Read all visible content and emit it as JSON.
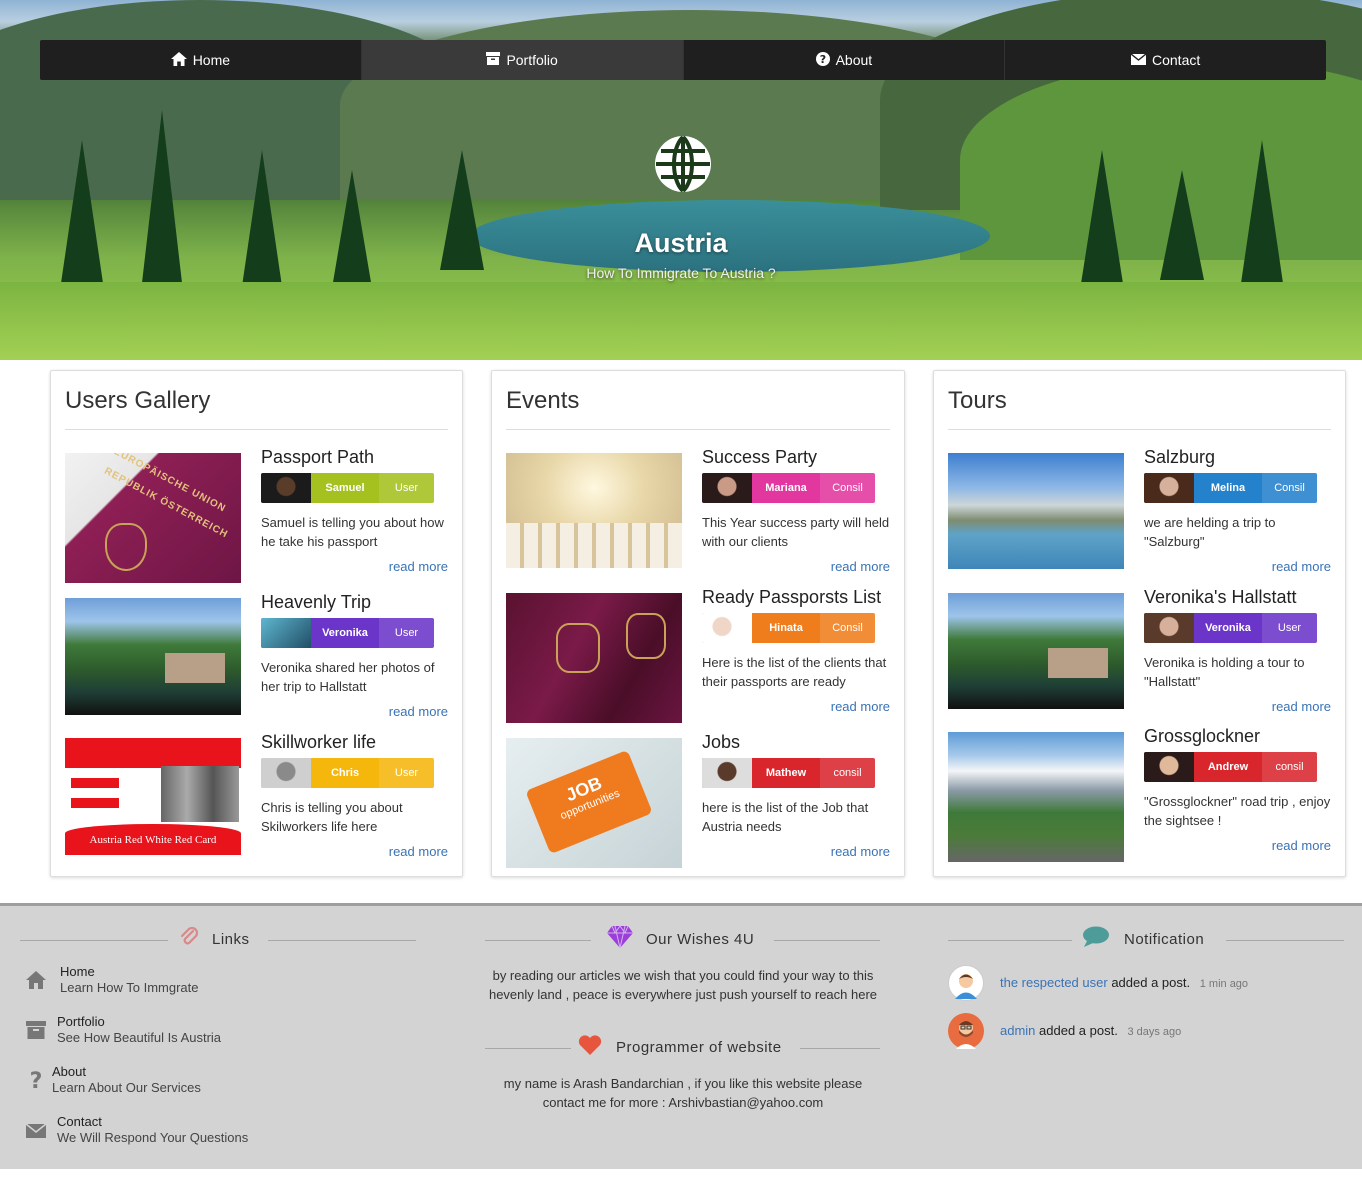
{
  "nav": {
    "items": [
      {
        "label": "Home",
        "icon": "home-icon"
      },
      {
        "label": "Portfolio",
        "icon": "archive-icon"
      },
      {
        "label": "About",
        "icon": "question-icon"
      },
      {
        "label": "Contact",
        "icon": "envelope-icon"
      }
    ],
    "active": "Portfolio"
  },
  "hero": {
    "title": "Austria",
    "subtitle": "How To Immigrate To Austria ?",
    "icon": "globe-icon"
  },
  "panels": [
    {
      "title": "Users Gallery",
      "items": [
        {
          "title": "Passport Path",
          "name": "Samuel",
          "role": "User",
          "color": "#a4c11f",
          "text": "Samuel is telling you about how he take his passport",
          "more": "read more"
        },
        {
          "title": "Heavenly Trip",
          "name": "Veronika",
          "role": "User",
          "color": "#6a35c8",
          "text": "Veronika shared her photos of her trip to Hallstatt",
          "more": "read more"
        },
        {
          "title": "Skillworker life",
          "name": "Chris",
          "role": "User",
          "color": "#f5b70c",
          "text": "Chris is telling you about Skilworkers life here",
          "more": "read more"
        }
      ]
    },
    {
      "title": "Events",
      "items": [
        {
          "title": "Success Party",
          "name": "Mariana",
          "role": "Consil",
          "color": "#e2379e",
          "text": "This Year success party will held with our clients",
          "more": "read more"
        },
        {
          "title": "Ready Passporsts List",
          "name": "Hinata",
          "role": "Consil",
          "color": "#f07d1c",
          "text": "Here is the list of the clients that their passports are ready",
          "more": "read more"
        },
        {
          "title": "Jobs",
          "name": "Mathew",
          "role": "consil",
          "color": "#d9262d",
          "text": "here is the list of the Job that Austria needs",
          "more": "read more"
        }
      ]
    },
    {
      "title": "Tours",
      "items": [
        {
          "title": "Salzburg",
          "name": "Melina",
          "role": "Consil",
          "color": "#2481cc",
          "text": "we are helding a trip to \"Salzburg\"",
          "more": "read more"
        },
        {
          "title": "Veronika's Hallstatt",
          "name": "Veronika",
          "role": "User",
          "color": "#6a35c8",
          "text": "Veronika is holding a tour to \"Hallstatt\"",
          "more": "read more"
        },
        {
          "title": "Grossglockner",
          "name": "Andrew",
          "role": "consil",
          "color": "#d9262d",
          "text": "\"Grossglockner\" road trip , enjoy the sightsee !",
          "more": "read more"
        }
      ]
    }
  ],
  "gallery_captions": {
    "red_card": "Austria Red White Red Card",
    "passport_top": "EUROPÄISCHE UNION",
    "passport_country": "REPUBLIK ÖSTERREICH",
    "job_line1": "JOB",
    "job_line2": "opportunities"
  },
  "footer": {
    "links_title": "Links",
    "links": [
      {
        "name": "Home",
        "desc": "Learn How To Immgrate",
        "icon": "home-icon"
      },
      {
        "name": "Portfolio",
        "desc": "See How Beautiful Is Austria",
        "icon": "archive-icon"
      },
      {
        "name": "About",
        "desc": "Learn About Our Services",
        "icon": "question-icon"
      },
      {
        "name": "Contact",
        "desc": "We Will Respond Your Questions",
        "icon": "envelope-icon"
      }
    ],
    "wishes_title": "Our Wishes 4U",
    "wishes_text": "by reading our articles we wish that you could find your way to this hevenly land , peace is everywhere just push yourself to reach here",
    "programmer_title": "Programmer of website",
    "programmer_text": "my name is Arash Bandarchian , if you like this website please contact me for more : Arshivbastian@yahoo.com",
    "notification_title": "Notification",
    "notifications": [
      {
        "user": "the respected user",
        "action": "added a post.",
        "time": "1 min ago"
      },
      {
        "user": "admin",
        "action": "added a post.",
        "time": "3 days ago"
      }
    ]
  }
}
